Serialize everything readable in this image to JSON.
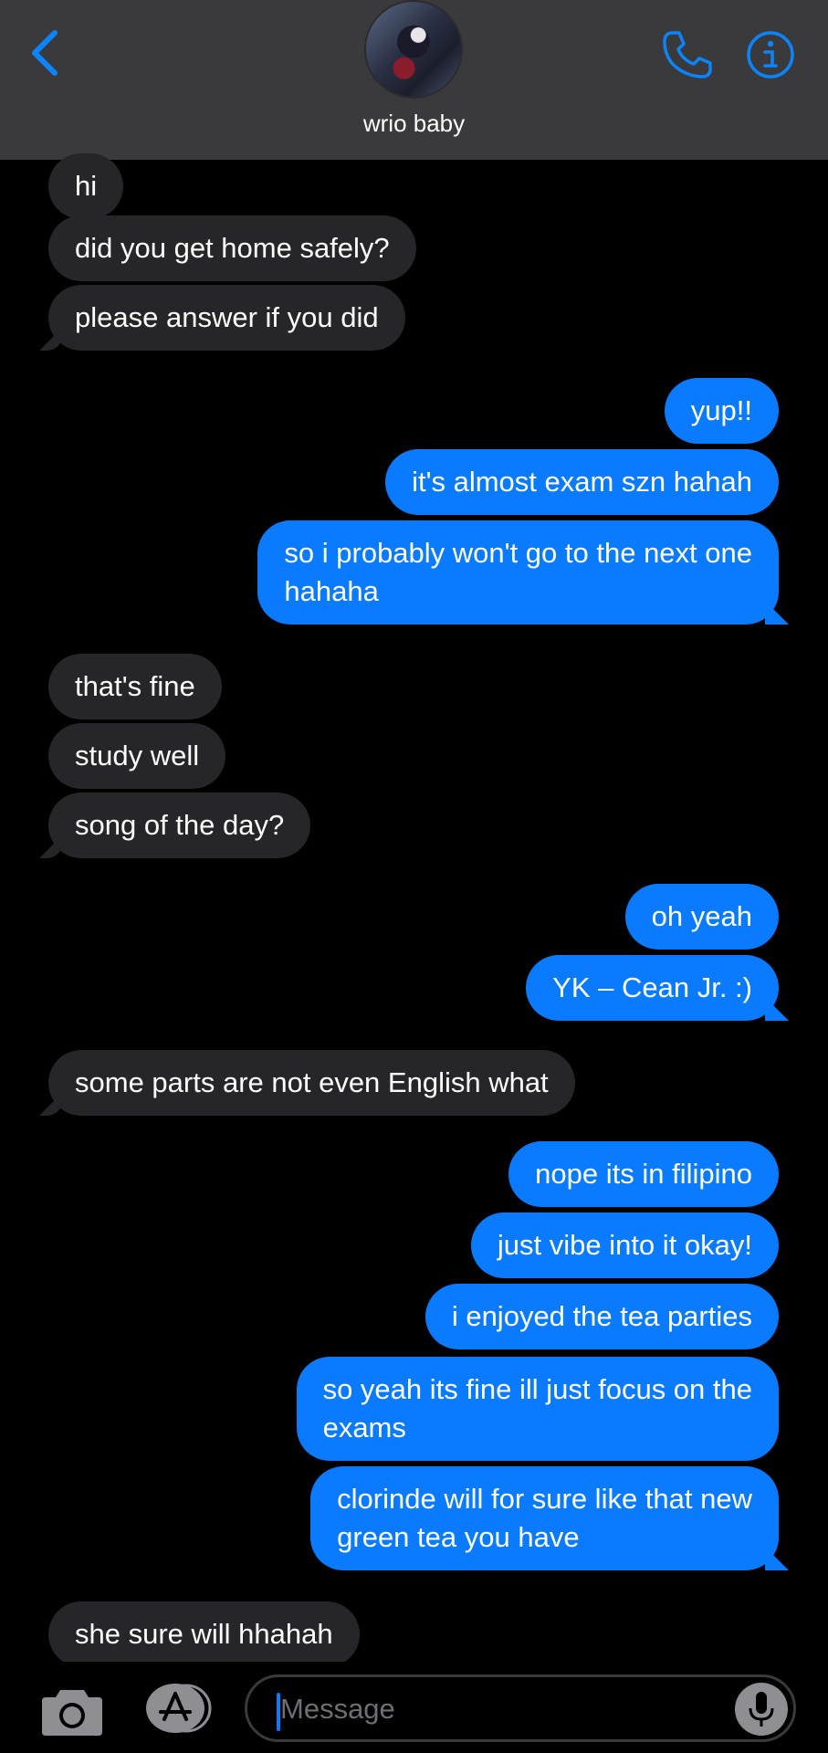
{
  "contact": {
    "name": "wrio baby"
  },
  "colors": {
    "sent_bubble": "#0a7aff",
    "received_bubble": "#262628",
    "header_bg": "#3a3a3c",
    "accent": "#0a7aff"
  },
  "icons": {
    "back": "chevron-left-icon",
    "call": "phone-icon",
    "info": "info-icon",
    "camera": "camera-icon",
    "apps": "app-store-icon",
    "mic": "microphone-icon"
  },
  "messages": [
    {
      "from": "them",
      "text": "hi"
    },
    {
      "from": "them",
      "text": "did you get home safely?"
    },
    {
      "from": "them",
      "text": "please answer if you did"
    },
    {
      "from": "me",
      "text": "yup!!"
    },
    {
      "from": "me",
      "text": "it's almost exam szn hahah"
    },
    {
      "from": "me",
      "text": "so i probably won't go to the next one\nhahaha"
    },
    {
      "from": "them",
      "text": "that's fine"
    },
    {
      "from": "them",
      "text": "study well"
    },
    {
      "from": "them",
      "text": "song of the day?"
    },
    {
      "from": "me",
      "text": "oh yeah"
    },
    {
      "from": "me",
      "text": "YK – Cean Jr. :)"
    },
    {
      "from": "them",
      "text": "some parts are not even English what"
    },
    {
      "from": "me",
      "text": "nope its in filipino"
    },
    {
      "from": "me",
      "text": "just vibe into it okay!"
    },
    {
      "from": "me",
      "text": "i enjoyed the tea parties"
    },
    {
      "from": "me",
      "text": "so yeah its fine ill just focus on the\nexams"
    },
    {
      "from": "me",
      "text": "clorinde will for sure like that new\ngreen tea you have"
    },
    {
      "from": "them",
      "text": "she sure will hhahah"
    }
  ],
  "composer": {
    "placeholder": "Message"
  }
}
